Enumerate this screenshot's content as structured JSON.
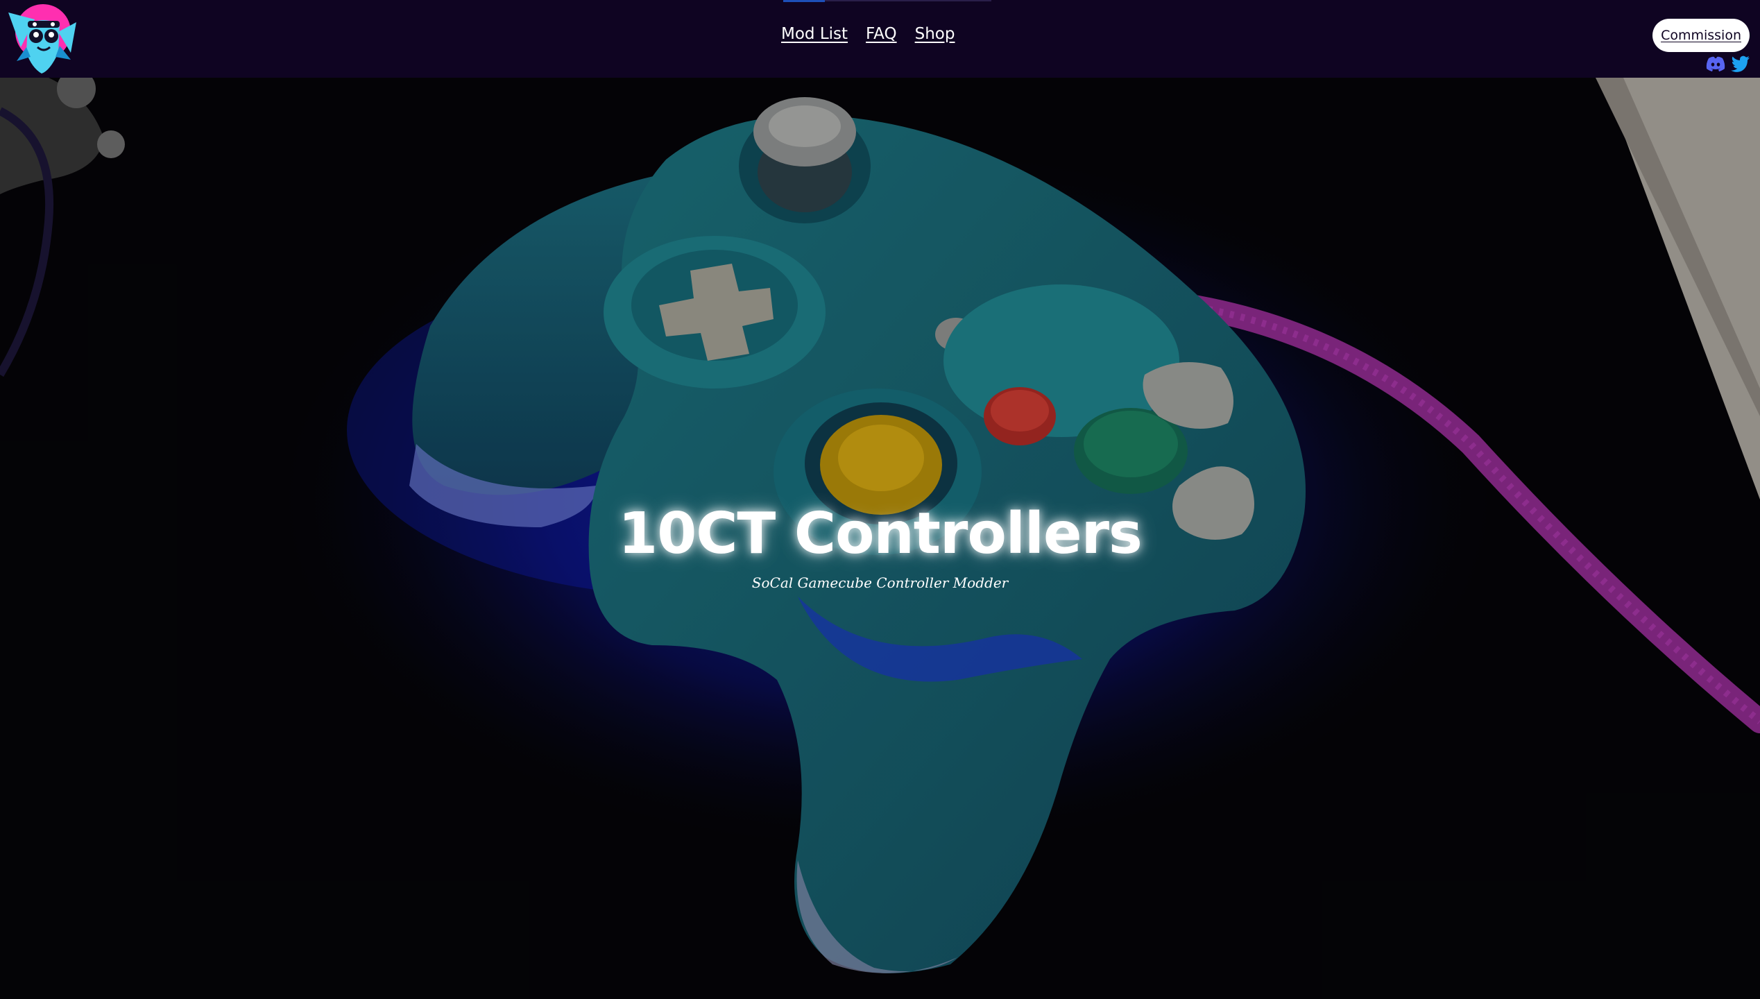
{
  "nav": {
    "items": [
      {
        "label": "Mod List"
      },
      {
        "label": "FAQ"
      },
      {
        "label": "Shop"
      }
    ]
  },
  "header": {
    "commission_label": "Commission",
    "logo_icon": "mascot-logo-icon",
    "social_icons": [
      "discord-icon",
      "twitter-icon"
    ]
  },
  "hero": {
    "title": "10CT Controllers",
    "subtitle": "SoCal Gamecube Controller Modder",
    "background_image": "gamecube-controller-photo"
  },
  "colors": {
    "nav_bg": "#0f0422",
    "accent_pink": "#ff2fb0",
    "accent_cyan": "#4fd2f0",
    "discord": "#5865f2",
    "twitter": "#1da1f2"
  }
}
